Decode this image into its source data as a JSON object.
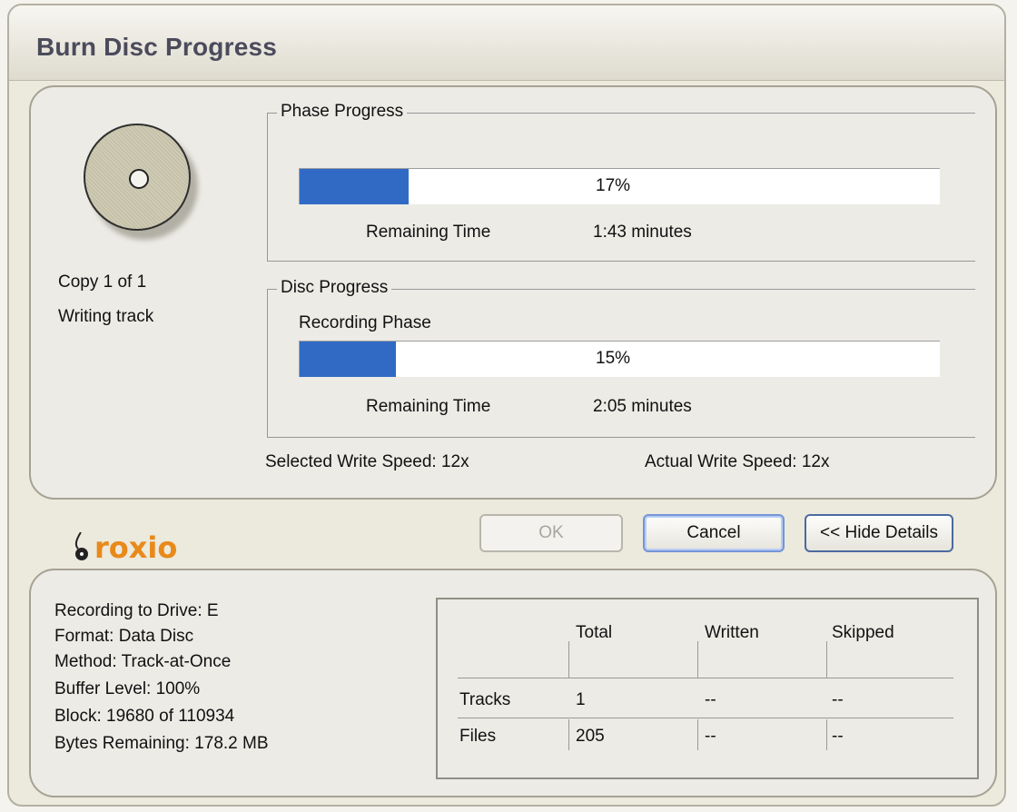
{
  "window": {
    "title": "Burn Disc Progress"
  },
  "status": {
    "copy": "Copy 1 of 1",
    "activity": "Writing track"
  },
  "phase_progress": {
    "legend": "Phase Progress",
    "percent_label": "17%",
    "fraction": 0.17,
    "remaining_label": "Remaining Time",
    "remaining_value": "1:43 minutes"
  },
  "disc_progress": {
    "legend": "Disc Progress",
    "phase_name": "Recording Phase",
    "percent_label": "15%",
    "fraction": 0.15,
    "remaining_label": "Remaining Time",
    "remaining_value": "2:05 minutes"
  },
  "speeds": {
    "selected": "Selected Write Speed: 12x",
    "actual": "Actual Write Speed: 12x"
  },
  "logo": {
    "text": "roxio"
  },
  "buttons": {
    "ok": "OK",
    "cancel": "Cancel",
    "hide_details": "<< Hide Details"
  },
  "details": {
    "lines": [
      "Recording to Drive: E",
      "Format: Data Disc",
      "Method: Track-at-Once",
      "Buffer Level:  100%",
      "Block:   19680 of 110934",
      "Bytes Remaining:    178.2 MB"
    ],
    "table": {
      "headers": [
        "Total",
        "Written",
        "Skipped"
      ],
      "rows": [
        {
          "label": "Tracks",
          "total": "1",
          "written": "--",
          "skipped": "--"
        },
        {
          "label": "Files",
          "total": "205",
          "written": "--",
          "skipped": "--"
        }
      ]
    }
  },
  "colors": {
    "progress_fill": "#316ac5",
    "logo": "#e88a1a"
  }
}
